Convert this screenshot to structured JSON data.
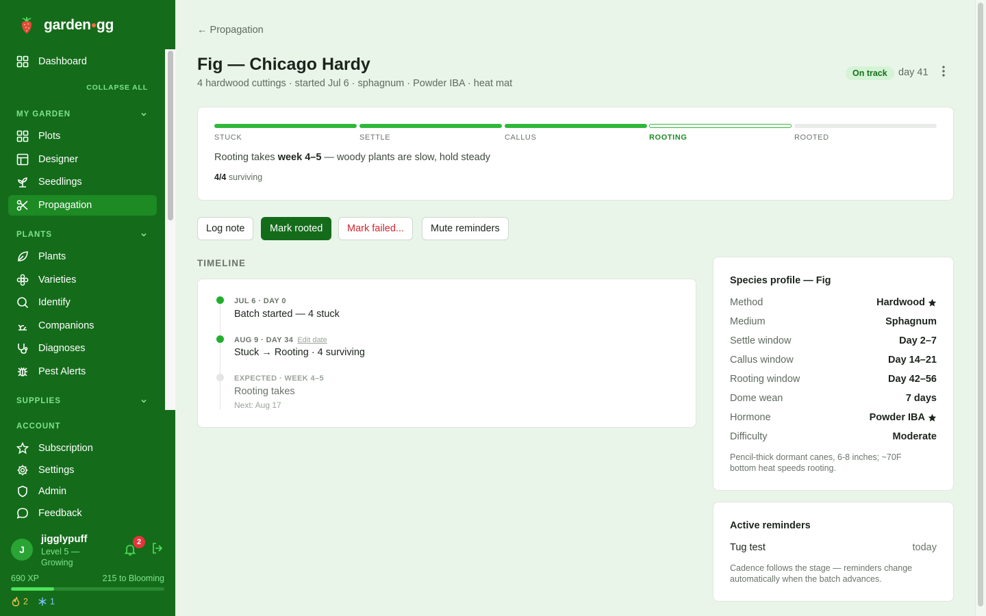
{
  "brand": {
    "name_left": "garden",
    "name_right": "gg"
  },
  "sidebar": {
    "dashboard": "Dashboard",
    "collapse_all": "COLLAPSE ALL",
    "my_garden": {
      "heading": "MY GARDEN",
      "items": [
        "Plots",
        "Designer",
        "Seedlings",
        "Propagation"
      ]
    },
    "plants": {
      "heading": "PLANTS",
      "items": [
        "Plants",
        "Varieties",
        "Identify",
        "Companions",
        "Diagnoses",
        "Pest Alerts"
      ]
    },
    "supplies": {
      "heading": "SUPPLIES"
    },
    "account": {
      "heading": "ACCOUNT",
      "items": [
        "Subscription",
        "Settings",
        "Admin",
        "Feedback"
      ]
    },
    "active_item": "Propagation"
  },
  "user": {
    "initial": "J",
    "name": "jigglypuff",
    "level": "Level 5 — Growing",
    "notifications": "2",
    "xp": "690 XP",
    "xp_next": "215 to Blooming",
    "xp_progress": 0.28,
    "streak": "2",
    "frost": "1"
  },
  "page": {
    "back": "← Propagation",
    "title": "Fig — Chicago Hardy",
    "subtitle": "4 hardwood cuttings · started Jul 6 · sphagnum · Powder IBA · heat mat",
    "status": "On track",
    "day": "day 41"
  },
  "stages": {
    "labels": [
      "STUCK",
      "SETTLE",
      "CALLUS",
      "ROOTING",
      "ROOTED"
    ],
    "states": [
      "done",
      "done",
      "done",
      "current",
      "todo"
    ],
    "note_prefix": "Rooting takes ",
    "note_bold": "week 4–5",
    "note_suffix": " — woody plants are slow, hold steady",
    "surviving_count": "4/4",
    "surviving_label": " surviving"
  },
  "actions": {
    "log_note": "Log note",
    "mark_rooted": "Mark rooted",
    "mark_failed": "Mark failed...",
    "mute": "Mute reminders"
  },
  "timeline": {
    "heading": "TIMELINE",
    "events": [
      {
        "meta": "JUL 6 · DAY 0",
        "title": "Batch started — 4 stuck"
      },
      {
        "meta": "AUG 9 · DAY 34",
        "edit": "Edit date",
        "title": "Stuck → Rooting · 4 surviving"
      },
      {
        "meta": "EXPECTED · WEEK 4–5",
        "title": "Rooting takes",
        "next": "Next: Aug 17"
      }
    ]
  },
  "profile": {
    "heading": "Species profile — Fig",
    "rows": [
      {
        "k": "Method",
        "v": "Hardwood",
        "star": true
      },
      {
        "k": "Medium",
        "v": "Sphagnum"
      },
      {
        "k": "Settle window",
        "v": "Day 2–7"
      },
      {
        "k": "Callus window",
        "v": "Day 14–21"
      },
      {
        "k": "Rooting window",
        "v": "Day 42–56"
      },
      {
        "k": "Dome wean",
        "v": "7 days"
      },
      {
        "k": "Hormone",
        "v": "Powder IBA",
        "star": true
      },
      {
        "k": "Difficulty",
        "v": "Moderate"
      }
    ],
    "note": "Pencil-thick dormant canes, 6-8 inches; ~70F bottom heat speeds rooting."
  },
  "reminders": {
    "heading": "Active reminders",
    "item": "Tug test",
    "when": "today",
    "note": "Cadence follows the stage — reminders change automatically when the batch advances."
  },
  "colors": {
    "sidebar": "#146c1b",
    "accent": "#2fb83a",
    "danger": "#d3252e"
  }
}
